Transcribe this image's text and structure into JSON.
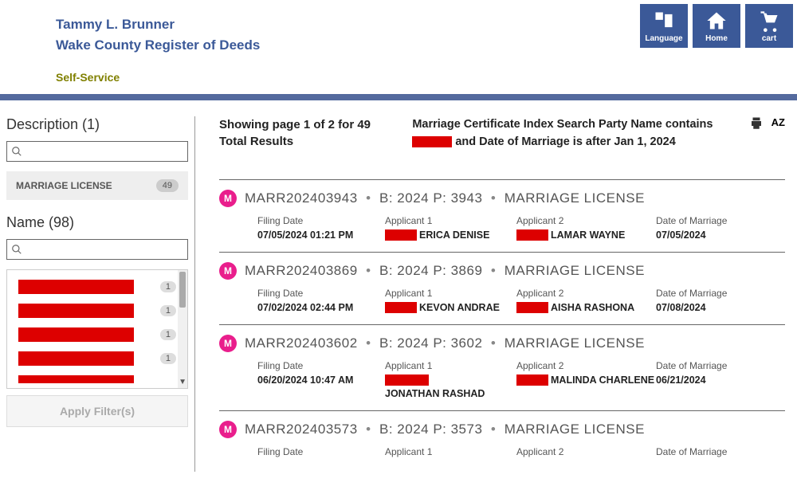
{
  "header": {
    "title1": "Tammy L. Brunner",
    "title2": "Wake County Register of Deeds",
    "subtitle": "Self-Service",
    "nav": {
      "language": "Language",
      "home": "Home",
      "cart": "cart"
    }
  },
  "sidebar": {
    "description": {
      "title": "Description (1)",
      "items": [
        {
          "label": "MARRIAGE LICENSE",
          "count": 49
        }
      ]
    },
    "name": {
      "title": "Name (98)",
      "items": [
        {
          "count": 1
        },
        {
          "count": 1
        },
        {
          "count": 1
        },
        {
          "count": 1
        },
        {
          "count": ""
        }
      ]
    },
    "apply_label": "Apply Filter(s)"
  },
  "content": {
    "results_text": "Showing page 1 of 2 for 49 Total Results",
    "search_desc_1": "Marriage Certificate Index Search Party Name contains ",
    "search_desc_2": " and Date of Marriage is after Jan 1, 2024",
    "sort_az": "AZ",
    "labels": {
      "filing_date": "Filing Date",
      "applicant1": "Applicant 1",
      "applicant2": "Applicant 2",
      "date_marriage": "Date of Marriage"
    },
    "results": [
      {
        "id": "MARR202403943",
        "bp": "B: 2024 P: 3943",
        "type": "MARRIAGE LICENSE",
        "filing": "07/05/2024 01:21 PM",
        "app1_red_w": 40,
        "app1": "ERICA DENISE",
        "app2_red_w": 40,
        "app2": "LAMAR WAYNE",
        "date": "07/05/2024"
      },
      {
        "id": "MARR202403869",
        "bp": "B: 2024 P: 3869",
        "type": "MARRIAGE LICENSE",
        "filing": "07/02/2024 02:44 PM",
        "app1_red_w": 40,
        "app1": "KEVON ANDRAE",
        "app2_red_w": 40,
        "app2": "AISHA RASHONA",
        "date": "07/08/2024"
      },
      {
        "id": "MARR202403602",
        "bp": "B: 2024 P: 3602",
        "type": "MARRIAGE LICENSE",
        "filing": "06/20/2024 10:47 AM",
        "app1_red_w": 55,
        "app1": "JONATHAN RASHAD",
        "app2_red_w": 40,
        "app2": "MALINDA CHARLENE",
        "date": "06/21/2024"
      },
      {
        "id": "MARR202403573",
        "bp": "B: 2024 P: 3573",
        "type": "MARRIAGE LICENSE",
        "filing": "",
        "app1_red_w": 0,
        "app1": "",
        "app2_red_w": 0,
        "app2": "",
        "date": ""
      }
    ]
  }
}
